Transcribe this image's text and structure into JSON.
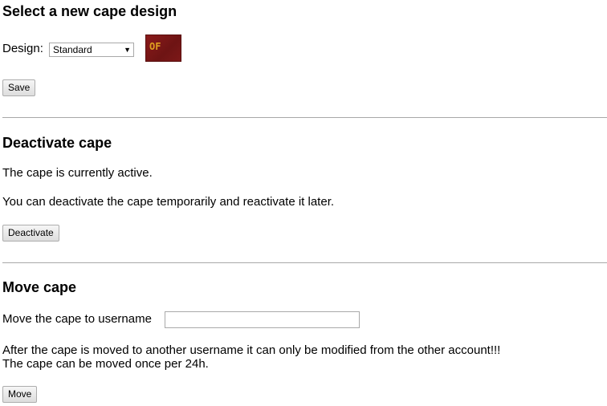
{
  "design_section": {
    "heading": "Select a new cape design",
    "design_label": "Design:",
    "design_selected": "Standard",
    "cape_preview_logo": "OF",
    "save_label": "Save"
  },
  "deactivate_section": {
    "heading": "Deactivate cape",
    "status_text": "The cape is currently active.",
    "info_text": "You can deactivate the cape temporarily and reactivate it later.",
    "deactivate_label": "Deactivate"
  },
  "move_section": {
    "heading": "Move cape",
    "username_label": "Move the cape to username",
    "username_value": "",
    "warning_line1": "After the cape is moved to another username it can only be modified from the other account!!!",
    "warning_line2": "The cape can be moved once per 24h.",
    "move_label": "Move"
  },
  "colors": {
    "cape_red": "#7c1818",
    "cape_logo": "#e0a020",
    "divider": "#a8a8a8"
  },
  "icons": {
    "select_arrow": "chevron-down-icon"
  }
}
